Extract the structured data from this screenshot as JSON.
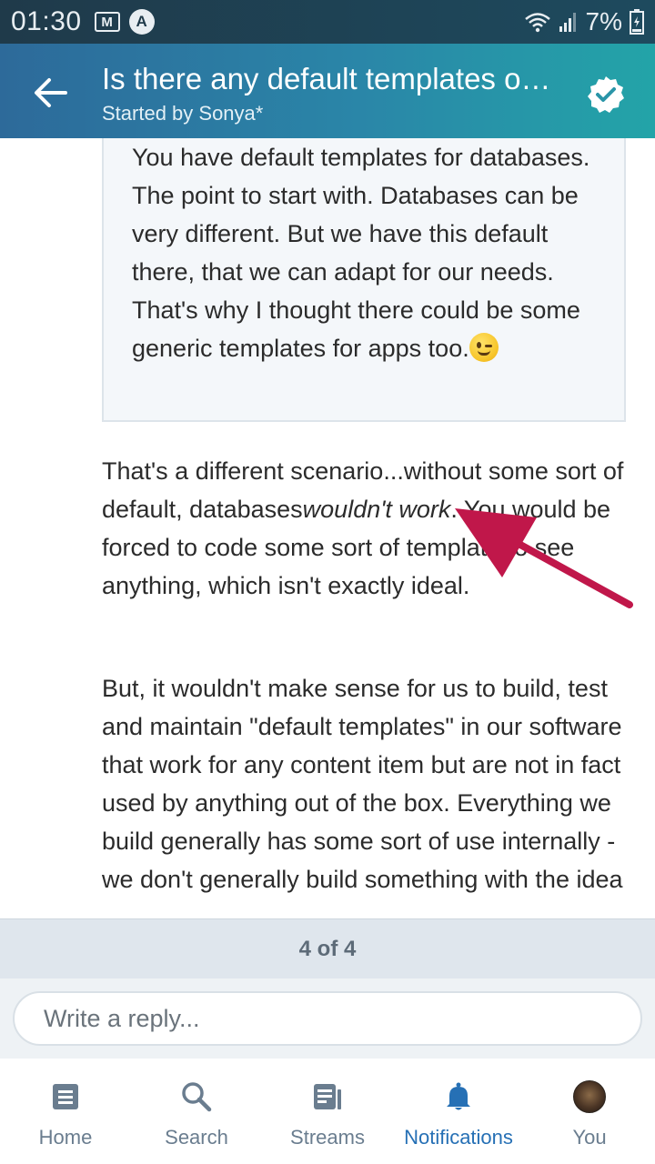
{
  "status_bar": {
    "time": "01:30",
    "battery": "7%",
    "mail_icon": "gmail-icon",
    "app_icon": "a-icon"
  },
  "header": {
    "title": "Is there any default templates o…",
    "subtitle": "Started by Sonya*",
    "back_icon": "arrow-left-icon",
    "check_icon": "verified-check-icon"
  },
  "post": {
    "quote": "You have default templates for databases. The point to start with. Databases can be very different. But we have this default there, that we can adapt for our needs. That's why I thought there could be some generic templates for apps too.",
    "para1_before": "That's a different scenario...without some sort of default, databases",
    "para1_em": "wouldn't work",
    "para1_after": ". You would be forced to code some sort of template to see anything, which isn't exactly ideal.",
    "para2": "But, it wouldn't make sense for us to build, test and maintain \"default templates\" in our software that work for any content item but are not in fact used by anything out of the box. Everything we build generally has some sort of use internally - we don't generally build something with the idea"
  },
  "pager": {
    "label": "4 of 4"
  },
  "reply": {
    "placeholder": "Write a reply..."
  },
  "nav": {
    "items": [
      {
        "label": "Home",
        "icon": "home-icon"
      },
      {
        "label": "Search",
        "icon": "search-icon"
      },
      {
        "label": "Streams",
        "icon": "streams-icon"
      },
      {
        "label": "Notifications",
        "icon": "bell-icon"
      },
      {
        "label": "You",
        "icon": "avatar"
      }
    ]
  },
  "colors": {
    "header_start": "#2d6a9a",
    "header_end": "#23a4a8",
    "active_nav": "#2670b5",
    "arrow": "#c0174a"
  }
}
